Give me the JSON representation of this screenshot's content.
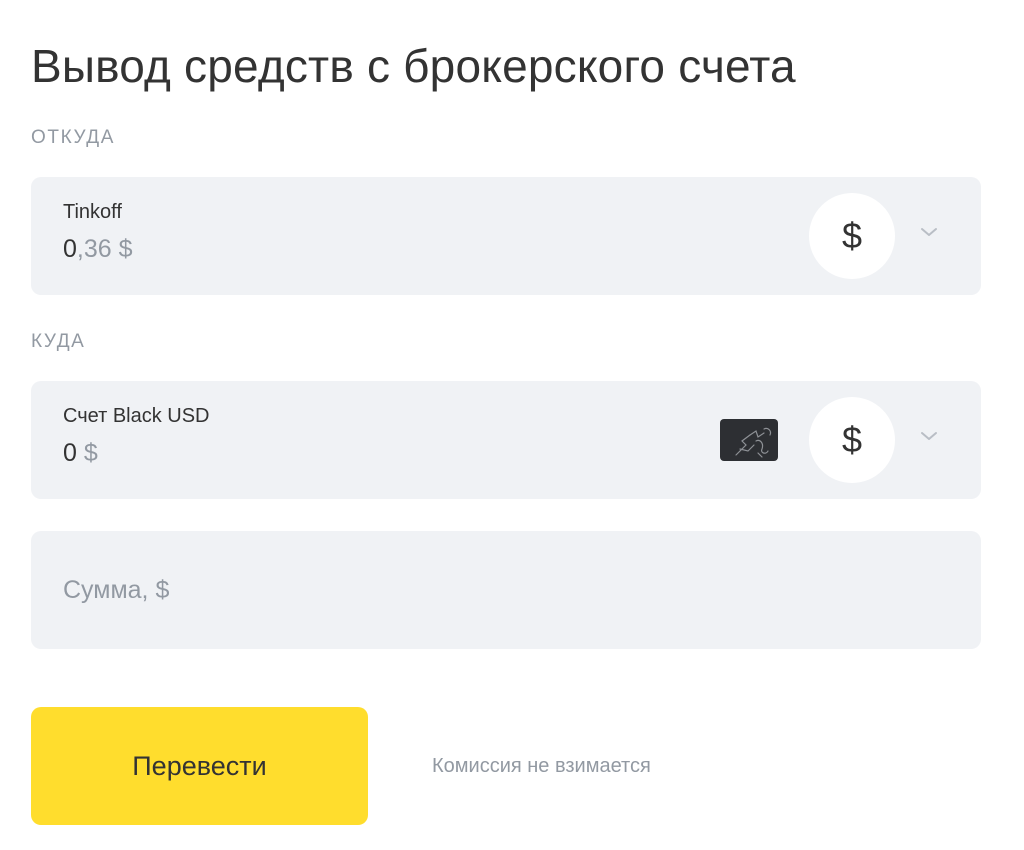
{
  "title": "Вывод средств с брокерского счета",
  "from": {
    "section_label": "ОТКУДА",
    "account_name": "Tinkoff",
    "balance_main": "0",
    "balance_rest": ",36 $",
    "currency_symbol": "$",
    "icon": "chevron-down-icon"
  },
  "to": {
    "section_label": "КУДА",
    "account_name": "Счет Black USD",
    "balance_main": "0",
    "balance_rest": " $",
    "currency_symbol": "$",
    "card_icon": "black-card-icon",
    "icon": "chevron-down-icon"
  },
  "amount": {
    "placeholder": "Сумма, $",
    "value": ""
  },
  "actions": {
    "transfer_label": "Перевести",
    "fee_note": "Комиссия не взимается"
  },
  "colors": {
    "accent": "#ffdd2d",
    "card_background": "#f0f2f5",
    "muted_text": "#9299a2",
    "text": "#333333"
  }
}
